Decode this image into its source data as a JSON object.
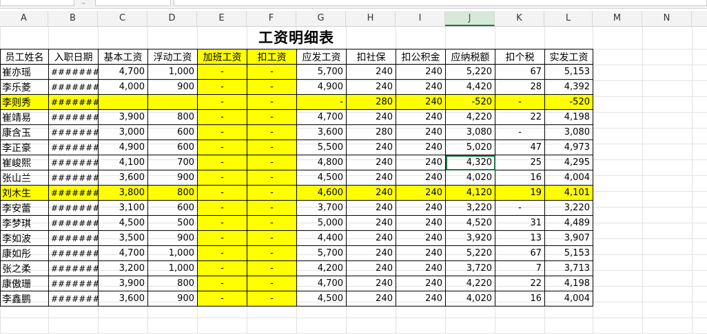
{
  "columns": [
    "A",
    "B",
    "C",
    "D",
    "E",
    "F",
    "G",
    "H",
    "I",
    "J",
    "K",
    "L",
    "M",
    "N"
  ],
  "title": "工资明细表",
  "headers": [
    "员工姓名",
    "入职日期",
    "基本工资",
    "浮动工资",
    "加班工资",
    "扣工资",
    "应发工资",
    "扣社保",
    "扣公积金",
    "应纳税额",
    "扣个税",
    "实发工资"
  ],
  "rows": [
    {
      "name": "崔亦瑶",
      "date": "########",
      "base": "4,700",
      "float": "1,000",
      "overtime": "-",
      "deduct": "-",
      "gross": "5,700",
      "social": "240",
      "fund": "240",
      "taxable": "5,220",
      "tax": "67",
      "net": "5,153"
    },
    {
      "name": "李乐菱",
      "date": "########",
      "base": "4,000",
      "float": "900",
      "overtime": "-",
      "deduct": "-",
      "gross": "4,900",
      "social": "240",
      "fund": "240",
      "taxable": "4,420",
      "tax": "28",
      "net": "4,392"
    },
    {
      "name": "李则秀",
      "date": "########",
      "base": "",
      "float": "",
      "overtime": "-",
      "deduct": "-",
      "gross": "-",
      "social": "280",
      "fund": "240",
      "taxable": "-520",
      "tax": "-",
      "net": "-520"
    },
    {
      "name": "崔靖易",
      "date": "########",
      "base": "3,900",
      "float": "800",
      "overtime": "-",
      "deduct": "-",
      "gross": "4,700",
      "social": "240",
      "fund": "240",
      "taxable": "4,220",
      "tax": "22",
      "net": "4,198"
    },
    {
      "name": "康含玉",
      "date": "########",
      "base": "3,000",
      "float": "600",
      "overtime": "-",
      "deduct": "-",
      "gross": "3,600",
      "social": "280",
      "fund": "240",
      "taxable": "3,080",
      "tax": "-",
      "net": "3,080"
    },
    {
      "name": "李正豪",
      "date": "########",
      "base": "4,900",
      "float": "600",
      "overtime": "-",
      "deduct": "-",
      "gross": "5,500",
      "social": "240",
      "fund": "240",
      "taxable": "5,020",
      "tax": "47",
      "net": "4,973"
    },
    {
      "name": "崔峻熙",
      "date": "########",
      "base": "4,100",
      "float": "700",
      "overtime": "-",
      "deduct": "-",
      "gross": "4,800",
      "social": "240",
      "fund": "240",
      "taxable": "4,320",
      "tax": "25",
      "net": "4,295"
    },
    {
      "name": "张山兰",
      "date": "########",
      "base": "3,600",
      "float": "900",
      "overtime": "-",
      "deduct": "-",
      "gross": "4,500",
      "social": "240",
      "fund": "240",
      "taxable": "4,020",
      "tax": "16",
      "net": "4,004"
    },
    {
      "name": "刘木生",
      "date": "########",
      "base": "3,800",
      "float": "800",
      "overtime": "-",
      "deduct": "-",
      "gross": "4,600",
      "social": "240",
      "fund": "240",
      "taxable": "4,120",
      "tax": "19",
      "net": "4,101"
    },
    {
      "name": "李安蕾",
      "date": "########",
      "base": "3,100",
      "float": "600",
      "overtime": "-",
      "deduct": "-",
      "gross": "3,700",
      "social": "240",
      "fund": "240",
      "taxable": "3,220",
      "tax": "-",
      "net": "3,220"
    },
    {
      "name": "李梦琪",
      "date": "########",
      "base": "4,500",
      "float": "500",
      "overtime": "-",
      "deduct": "-",
      "gross": "5,000",
      "social": "240",
      "fund": "240",
      "taxable": "4,520",
      "tax": "31",
      "net": "4,489"
    },
    {
      "name": "李如波",
      "date": "########",
      "base": "3,500",
      "float": "900",
      "overtime": "-",
      "deduct": "-",
      "gross": "4,400",
      "social": "240",
      "fund": "240",
      "taxable": "3,920",
      "tax": "13",
      "net": "3,907"
    },
    {
      "name": "康如彤",
      "date": "########",
      "base": "4,700",
      "float": "1,000",
      "overtime": "-",
      "deduct": "-",
      "gross": "5,700",
      "social": "240",
      "fund": "240",
      "taxable": "5,220",
      "tax": "67",
      "net": "5,153"
    },
    {
      "name": "张之柔",
      "date": "########",
      "base": "3,200",
      "float": "1,000",
      "overtime": "-",
      "deduct": "-",
      "gross": "4,200",
      "social": "240",
      "fund": "240",
      "taxable": "3,720",
      "tax": "7",
      "net": "3,713"
    },
    {
      "name": "康傲珊",
      "date": "########",
      "base": "3,900",
      "float": "800",
      "overtime": "-",
      "deduct": "-",
      "gross": "4,700",
      "social": "240",
      "fund": "240",
      "taxable": "4,220",
      "tax": "22",
      "net": "4,198"
    },
    {
      "name": "李鑫鹏",
      "date": "########",
      "base": "3,600",
      "float": "900",
      "overtime": "-",
      "deduct": "-",
      "gross": "4,500",
      "social": "240",
      "fund": "240",
      "taxable": "4,020",
      "tax": "16",
      "net": "4,004"
    }
  ],
  "highlight_color": "#ffff00",
  "selection_color": "#217346"
}
